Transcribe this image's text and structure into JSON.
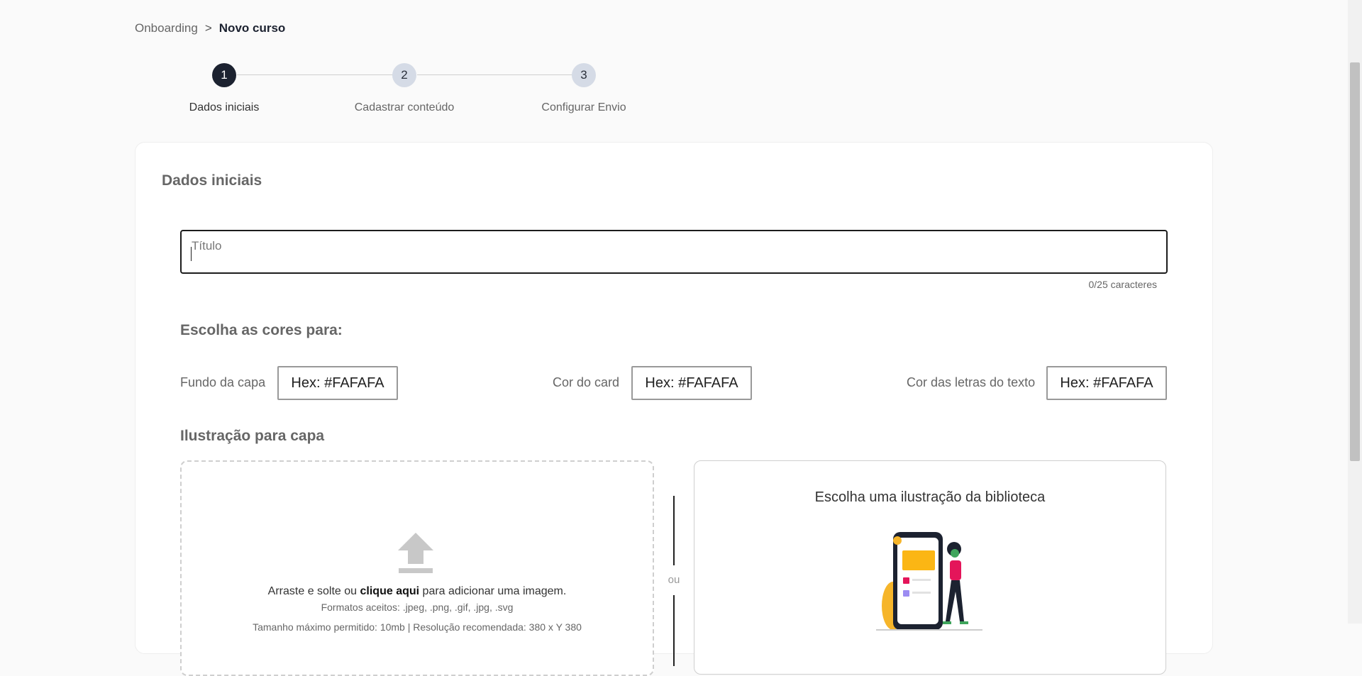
{
  "breadcrumb": {
    "parent": "Onboarding",
    "separator": ">",
    "current": "Novo curso"
  },
  "stepper": {
    "steps": [
      {
        "number": "1",
        "label": "Dados iniciais",
        "state": "active"
      },
      {
        "number": "2",
        "label": "Cadastrar conteúdo",
        "state": "pending"
      },
      {
        "number": "3",
        "label": "Configurar Envio",
        "state": "pending"
      }
    ]
  },
  "form": {
    "section_title": "Dados iniciais",
    "title_field": {
      "label": "Título",
      "value": "",
      "counter": "0/25 caracteres"
    },
    "colors": {
      "heading": "Escolha as cores para:",
      "items": [
        {
          "label": "Fundo da capa",
          "value": "Hex: #FAFAFA"
        },
        {
          "label": "Cor do card",
          "value": "Hex: #FAFAFA"
        },
        {
          "label": "Cor das letras do texto",
          "value": "Hex: #FAFAFA"
        }
      ]
    },
    "illustration": {
      "heading": "Ilustração para capa",
      "dropzone": {
        "text_before": "Arraste e solte ou ",
        "link": "clique aqui",
        "text_after": " para adicionar uma imagem.",
        "formats": "Formatos aceitos: .jpeg, .png, .gif, .jpg, .svg",
        "size_note": "Tamanho máximo permitido: 10mb | Resolução recomendada: 380 x Y 380"
      },
      "or_label": "ou",
      "library": {
        "title": "Escolha uma ilustração da biblioteca"
      }
    }
  },
  "colors": {
    "primary": "#1c2230",
    "step_pending": "#d5dbe6",
    "page_bg": "#fafafa"
  },
  "icons": [
    "upload-arrow-icon",
    "library-illustration"
  ]
}
